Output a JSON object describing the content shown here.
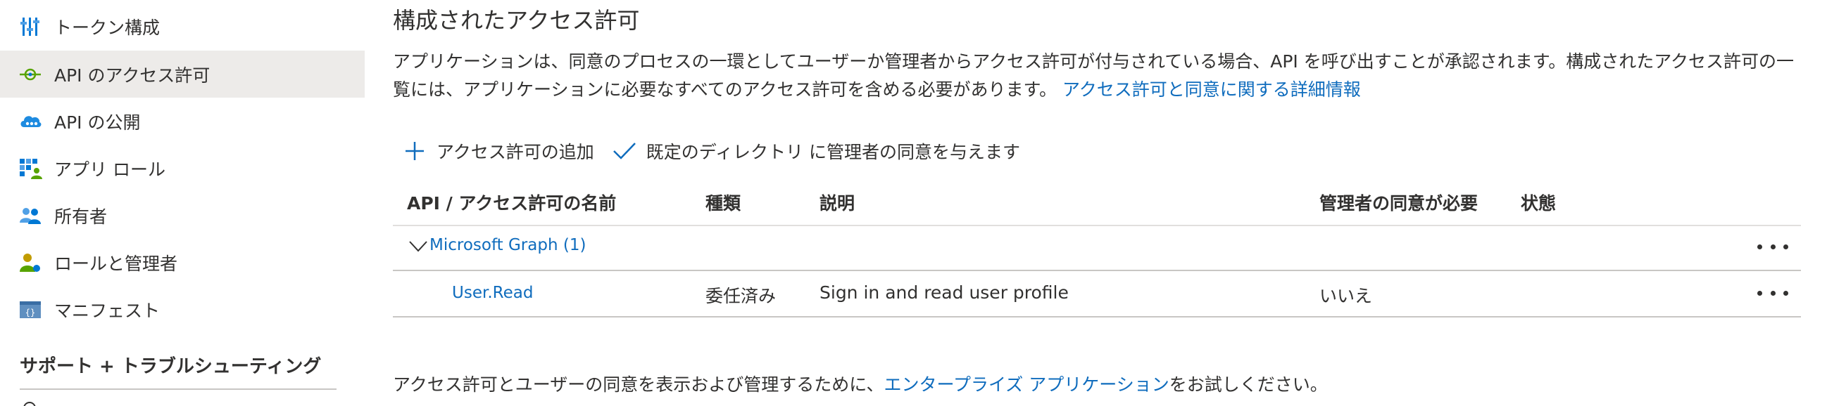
{
  "sidebar": {
    "items": [
      {
        "label": "トークン構成",
        "icon": "token-config-icon"
      },
      {
        "label": "API のアクセス許可",
        "icon": "api-permission-icon",
        "selected": true
      },
      {
        "label": "API の公開",
        "icon": "cloud-expose-api-icon"
      },
      {
        "label": "アプリ ロール",
        "icon": "app-roles-icon"
      },
      {
        "label": "所有者",
        "icon": "owners-icon"
      },
      {
        "label": "ロールと管理者",
        "icon": "roles-admins-icon"
      },
      {
        "label": "マニフェスト",
        "icon": "manifest-icon"
      }
    ],
    "section_title": "サポート + トラブルシューティング"
  },
  "main": {
    "title": "構成されたアクセス許可",
    "description": "アプリケーションは、同意のプロセスの一環としてユーザーか管理者からアクセス許可が付与されている場合、API を呼び出すことが承認されます。構成されたアクセス許可の一覧には、アプリケーションに必要なすべてのアクセス許可を含める必要があります。",
    "description_link": "アクセス許可と同意に関する詳細情報",
    "toolbar": {
      "add_permission": "アクセス許可の追加",
      "grant_consent": "既定のディレクトリ に管理者の同意を与えます"
    },
    "table": {
      "columns": [
        "API / アクセス許可の名前",
        "種類",
        "説明",
        "管理者の同意が必要",
        "状態"
      ],
      "group": {
        "label": "Microsoft Graph (1)"
      },
      "rows": [
        {
          "name": "User.Read",
          "type": "委任済み",
          "description": "Sign in and read user profile",
          "admin_consent": "いいえ",
          "status": ""
        }
      ]
    },
    "footer": {
      "prefix": "アクセス許可とユーザーの同意を表示および管理するために、",
      "link": "エンタープライズ アプリケーション",
      "suffix": "をお試しください。"
    }
  },
  "colors": {
    "link": "#0f6cbd",
    "selected_bg": "#edebe9",
    "text": "#323130",
    "divider": "#e1dfdd"
  }
}
